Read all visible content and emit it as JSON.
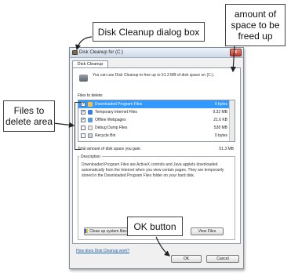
{
  "callouts": {
    "dialog": "Disk Cleanup dialog box",
    "space": [
      "amount of",
      "space to be",
      "freed up"
    ],
    "files": [
      "Files to",
      "delete area"
    ],
    "ok": "OK button"
  },
  "dialog": {
    "title": "Disk Cleanup for (C:)",
    "close_glyph": "x",
    "tab": "Disk Cleanup",
    "intro": "You can use Disk Cleanup to free up to 51.3 MB of disk space on (C:).",
    "files_label": "Files to delete:",
    "files": [
      {
        "name": "Downloaded Program Files",
        "size": "0 bytes",
        "checked": true,
        "selected": true
      },
      {
        "name": "Temporary Internet Files",
        "size": "9.32 MB",
        "checked": true,
        "selected": false
      },
      {
        "name": "Offline Webpages",
        "size": "21.6 KB",
        "checked": true,
        "selected": false
      },
      {
        "name": "Debug Dump Files",
        "size": "538 MB",
        "checked": false,
        "selected": false
      },
      {
        "name": "Recycle Bin",
        "size": "0 bytes",
        "checked": false,
        "selected": false
      }
    ],
    "check_glyph": "✓",
    "total_label": "Total amount of disk space you gain:",
    "total_value": "51.3 MB",
    "description_label": "Description",
    "description": "Downloaded Program Files are ActiveX controls and Java applets downloaded automatically from the Internet when you view certain pages. They are temporarily stored in the Downloaded Program Files folder on your hard disk.",
    "cleanup_button": "Clean up system files",
    "view_files_button": "View Files",
    "help_link": "How does Disk Cleanup work?",
    "ok_button": "OK",
    "cancel_button": "Cancel"
  },
  "colors": {
    "selection": "#3399ff",
    "title_gradient_top": "#eef3f9",
    "link": "#1a5fb4"
  }
}
